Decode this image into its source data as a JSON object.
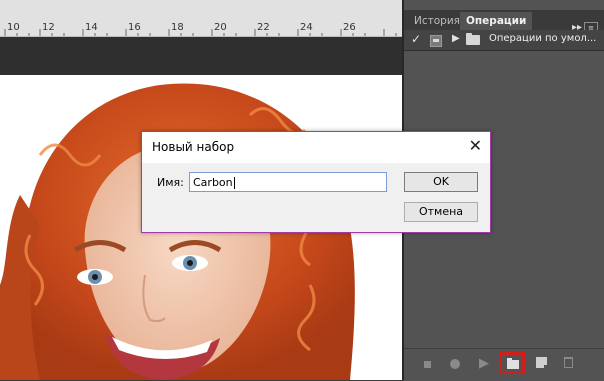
{
  "ruler": {
    "numbers": [
      "10",
      "12",
      "14",
      "16",
      "18",
      "20",
      "22",
      "24",
      "26"
    ]
  },
  "panel": {
    "tabs": [
      {
        "label": "История",
        "active": false
      },
      {
        "label": "Операции",
        "active": true
      }
    ],
    "collapse_glyph": "▸▸",
    "menu_glyph": "≡",
    "action_set": {
      "checked": true,
      "label": "Операции по умол..."
    },
    "footer": {
      "stop_icon": "stop-icon",
      "record_icon": "record-icon",
      "play_icon": "play-icon",
      "new_set_icon": "folder-icon",
      "new_action_icon": "new-action-icon",
      "delete_icon": "trash-icon",
      "highlight_color": "#d0201b"
    }
  },
  "dialog": {
    "title": "Новый набор",
    "close_glyph": "✕",
    "name_label": "Имя:",
    "name_value": "Carbon",
    "ok_label": "OK",
    "cancel_label": "Отмена",
    "border_color": "#a23aa7"
  }
}
